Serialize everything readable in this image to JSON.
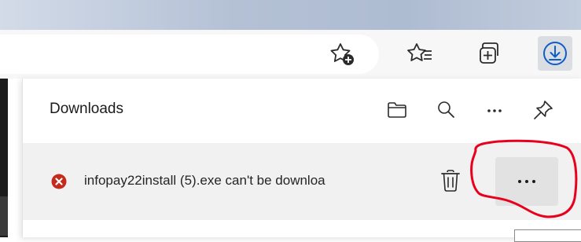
{
  "browser": {
    "toolbar_icons": [
      "add-favorite-icon",
      "favorites-icon",
      "collections-icon",
      "downloads-icon"
    ]
  },
  "downloads_panel": {
    "title": "Downloads",
    "header_icons": [
      "folder-icon",
      "search-icon",
      "more-options-icon",
      "pin-icon"
    ],
    "item": {
      "status_icon": "error-icon",
      "status_color": "#c42b1c",
      "text": "infopay22install (5).exe can't be downloa"
    },
    "annotation_color": "#e8001c"
  }
}
